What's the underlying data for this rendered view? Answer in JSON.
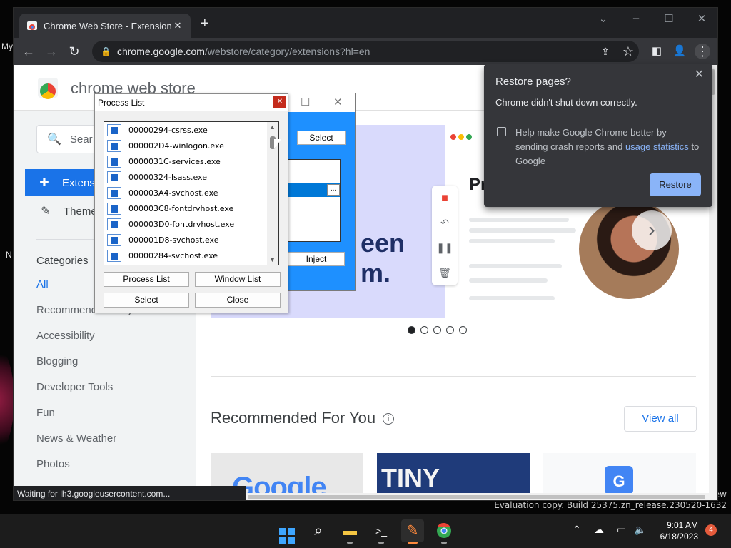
{
  "desktop": {
    "left_text_1": "My",
    "left_text_2": "N",
    "watermark_line1": "ew",
    "watermark_line2": "Evaluation copy. Build 25375.zn_release.230520-1632"
  },
  "browser": {
    "tab_title": "Chrome Web Store - Extensions",
    "url_host": "chrome.google.com",
    "url_path": "/webstore/category/extensions?hl=en",
    "status_text": "Waiting for lh3.googleusercontent.com..."
  },
  "store": {
    "title": "chrome web store",
    "search_placeholder": "Sear",
    "nav": {
      "extensions": "Extensi",
      "themes": "Theme"
    },
    "categories_head": "Categories",
    "categories": [
      "All",
      "Recommended for you",
      "Accessibility",
      "Blogging",
      "Developer Tools",
      "Fun",
      "News & Weather",
      "Photos"
    ],
    "banner_text_1": "een",
    "banner_text_2": "m.",
    "banner_card_title": "Pr",
    "recommended_title": "Recommended For You",
    "view_all": "View all",
    "thumb1_text": "Google",
    "thumb2_text": "TINY",
    "thumb3_text": "G"
  },
  "restore": {
    "title": "Restore pages?",
    "message": "Chrome didn't shut down correctly.",
    "option_text": "Help make Google Chrome better by sending crash reports and",
    "option_link": "usage statistics",
    "option_tail": "to Google",
    "button": "Restore"
  },
  "injector": {
    "select": "Select",
    "inject": "Inject",
    "dots": "..."
  },
  "process_list": {
    "title": "Process List",
    "items": [
      "00000294-csrss.exe",
      "000002D4-winlogon.exe",
      "0000031C-services.exe",
      "00000324-lsass.exe",
      "000003A4-svchost.exe",
      "000003C8-fontdrvhost.exe",
      "000003D0-fontdrvhost.exe",
      "000001D8-svchost.exe",
      "00000284-svchost.exe"
    ],
    "buttons": {
      "process_list": "Process List",
      "window_list": "Window List",
      "select": "Select",
      "close": "Close"
    }
  },
  "taskbar": {
    "time": "9:01 AM",
    "date": "6/18/2023",
    "notification_count": "4"
  }
}
